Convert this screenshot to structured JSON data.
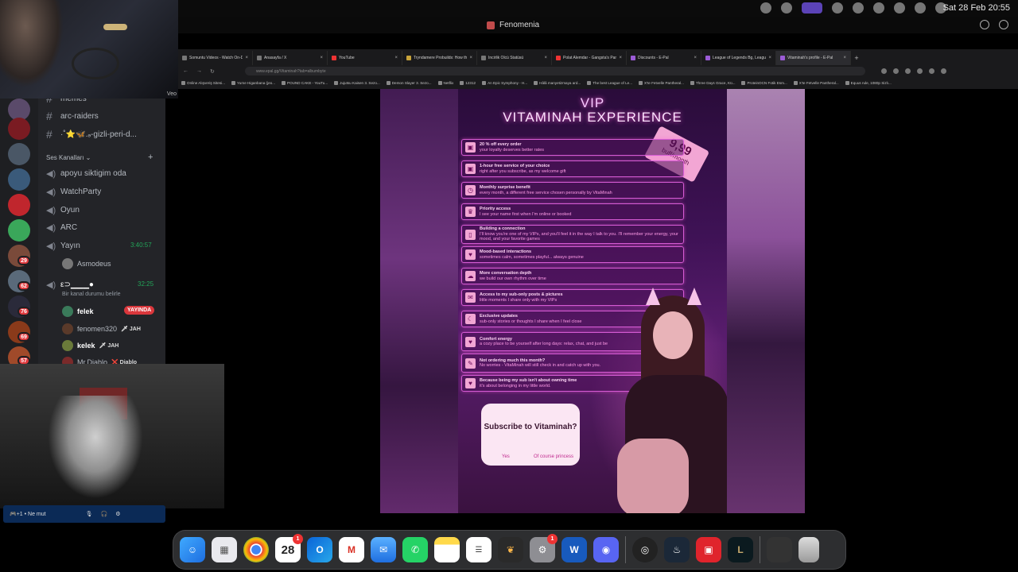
{
  "menubar": {
    "date_time": "Sat 28 Feb  20:55",
    "status_icons": [
      "control-center-icon",
      "record-icon",
      "play-icon",
      "fan-icon",
      "wifi-icon",
      "battery-icon",
      "user-icon"
    ]
  },
  "window": {
    "title": "Fenomenia"
  },
  "browser": {
    "tabs": [
      {
        "label": "Somuntu Videos - Watch On-Dr",
        "active": false
      },
      {
        "label": "Anasayfa / X",
        "active": false
      },
      {
        "label": "YouTube",
        "active": false
      },
      {
        "label": "Tryndamere Probuilds: How the",
        "active": false
      },
      {
        "label": "İncirlik Ölcü Statüsü",
        "active": false
      },
      {
        "label": "Polat Alemdar - Gangsta's Para",
        "active": false
      },
      {
        "label": "Discounts - E-Pal",
        "active": false
      },
      {
        "label": "League of Legends Bg, League",
        "active": false
      },
      {
        "label": "Vitaminah's profile - E-Pal",
        "active": true
      }
    ],
    "new_tab": "+",
    "url": "www.epal.gg/Vitaminah?tab=albumbyte",
    "bookmarks": [
      "Online Alışveriş Sitesi...",
      "Yume Higanbana (jeo...",
      "POUND CAKE - YouTu...",
      "Jujutsu Kaisen 3. Sezo...",
      "Demon Slayer 3. Sezo...",
      "Netflix",
      "12312",
      "An Epic Symphony - H...",
      "Hâlâ manyetizmaya ard...",
      "The best League of Le...",
      "X'te Fetvelle Pantheral...",
      "Three Days Grace, Kü...",
      "ProteinOCN Fotik Esm...",
      "X'te Fetvelle Pantheral...",
      "Equus rule, 1080p Sizlı..."
    ]
  },
  "discord": {
    "channels": [
      {
        "kind": "text",
        "label": "memes"
      },
      {
        "kind": "text",
        "label": "arc-raiders"
      },
      {
        "kind": "text",
        "label": "·˚⭐🦋.ₔ-gizli-peri-d..."
      }
    ],
    "voice_header": "Ses Kanalları",
    "add": "+",
    "voice_channels": [
      {
        "label": "apoyu siktigim oda"
      },
      {
        "label": "WatchParty"
      },
      {
        "label": "Oyun"
      },
      {
        "label": "ARC"
      },
      {
        "label": "Yayın",
        "time": "3:40:57"
      }
    ],
    "yayin_user": "Asmodeus",
    "current_channel": {
      "label": "ε⊃▁▁▁●",
      "time": "32:25",
      "status": "Bir kanal durumu belirle"
    },
    "members": [
      {
        "name": "felek",
        "badge": "YAYINDA"
      },
      {
        "name": "fenomen320",
        "badge": "🗡 JAH"
      },
      {
        "name": "kelek",
        "badge": "🗡 JAH"
      },
      {
        "name": "Mr.Diablo",
        "badge": "❌ Diablo"
      }
    ],
    "server_badges": [
      "29",
      "62",
      "76",
      "69",
      "57"
    ],
    "voice_bar": "🎮+1 • Ne mut",
    "webcam_label": "Veo"
  },
  "poster": {
    "vip": "VIP",
    "title": "VITAMINAH EXPERIENCE",
    "price": "9,99",
    "price_sub": "buff/month",
    "perks": [
      {
        "title": "20 % off every order",
        "sub": "your loyalty deserves better rates"
      },
      {
        "title": "1-hour free service of your choice",
        "sub": "right after you subscribe, as my welcome gift"
      },
      {
        "title": "Monthly surprise benefit",
        "sub": "every month, a different free service chosen personally by VitaMinah"
      },
      {
        "title": "Priority access",
        "sub": "I see your name first when I'm online or booked"
      },
      {
        "title": "Building a connection",
        "sub": "I'll know you're one of my VIPs, and you'll feel it in the way I talk to you. I'll remember your energy, your mood, and your favorite games"
      },
      {
        "title": "Mood-based interactions",
        "sub": "sometimes calm, sometimes playful... always genuine"
      },
      {
        "title": "More conversation depth",
        "sub": "we build our own rhythm over time"
      },
      {
        "title": "Access to my sub-only posts & pictures",
        "sub": "little moments I share only with my VIPs"
      },
      {
        "title": "Exclusive updates",
        "sub": "sub-only stories or thoughts I share when I feel close"
      },
      {
        "title": "Comfort energy",
        "sub": "a cozy place to be yourself after long days: relax, chat, and just be"
      },
      {
        "title": "Not ordering much this month?",
        "sub": "No worries - VitaMinah will still check in and catch up with you."
      },
      {
        "title": "Because being my sub isn't about owning time",
        "sub": "it's about belonging in my little world."
      }
    ],
    "subscribe": {
      "question": "Subscribe to Vitaminah?",
      "yes": "Yes",
      "of_course": "Of course princess"
    }
  },
  "dock": {
    "calendar_day": "28",
    "badges": {
      "calendar": "1",
      "settings": "1"
    },
    "apps": [
      "finder",
      "launchpad",
      "chrome",
      "calendar",
      "outlook",
      "gmail",
      "mail",
      "whatsapp",
      "notes",
      "reminders",
      "fl-studio",
      "settings",
      "word",
      "discord",
      "obs",
      "steam",
      "epic",
      "league",
      "screenshot",
      "trash"
    ]
  },
  "colors": {
    "poster_pink": "#f2a6d4",
    "neon": "#ff5bd8",
    "discord_live": "#da373c"
  }
}
